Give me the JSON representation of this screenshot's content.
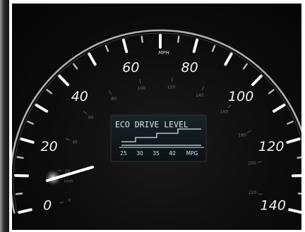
{
  "speedometer": {
    "unit_label": "MPH",
    "secondary_unit_label": "km/h",
    "reading": 0,
    "outer_scale": [
      "0",
      "20",
      "40",
      "60",
      "80",
      "100",
      "120",
      "140"
    ],
    "inner_scale": [
      "0",
      "20",
      "40",
      "60",
      "80",
      "100",
      "120",
      "140",
      "160",
      "180",
      "200",
      "220"
    ],
    "colors": {
      "background": "#0c0c0c",
      "major_tick": "#f5f5f5",
      "minor_tick": "#bdbdbd",
      "needle": "#ffffff",
      "display_text": "#cfe4ee"
    }
  },
  "eco_display": {
    "title": "ECO DRIVE LEVEL",
    "scale": [
      "25",
      "30",
      "35",
      "40"
    ],
    "scale_unit": "MPG"
  }
}
